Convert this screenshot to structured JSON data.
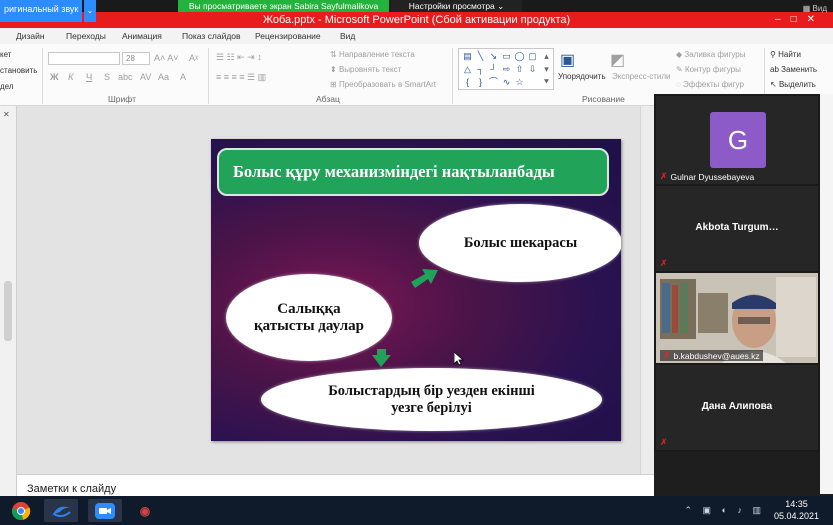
{
  "zoom": {
    "original_sound": "ригинальный звук",
    "share_banner": "Вы просматриваете экран Sabira Sayfulmalikova",
    "view_options": "Настройки просмотра ⌄",
    "view_label": "Вид"
  },
  "powerpoint": {
    "title": "Жоба.pptx  -  Microsoft PowerPoint (Сбой активации продукта)",
    "tabs": [
      "Дизайн",
      "Переходы",
      "Анимация",
      "Показ слайдов",
      "Рецензирование",
      "Вид"
    ],
    "clipboard": {
      "cut": "кет",
      "copy": "становить",
      "paste": "дел"
    },
    "font_size": "28",
    "font_group_label": "Шрифт",
    "paragraph_group_label": "Абзац",
    "text_direction": "Направление текста",
    "align_text": "Выровнять текст",
    "convert_smartart": "Преобразовать в SmartArt",
    "arrange": "Упорядочить",
    "express_styles": "Экспресс-стили",
    "drawing_group_label": "Рисование",
    "shape_fill": "Заливка фигуры",
    "shape_outline": "Контур фигуры",
    "shape_effects": "Эффекты фигур",
    "find": "Найти",
    "replace": "Заменить",
    "select": "Выделить",
    "notes_placeholder": "Заметки к слайду"
  },
  "slide": {
    "title": "Болыс құру механизміндегі нақтыланбады",
    "ellipse_border": "Болыс шекарасы",
    "ellipse_tax_line1": "Салыққа",
    "ellipse_tax_line2": "қатысты даулар",
    "ellipse_division_line1": "Болыстардың бір уезден екінші",
    "ellipse_division_line2": "уезге берілуі"
  },
  "participants": [
    {
      "name": "Gulnar Dyussebayeva",
      "avatar_letter": "G",
      "muted": true
    },
    {
      "name": "Akbota  Turgum…",
      "muted": true
    },
    {
      "name": "b.kabdushev@aues.kz",
      "muted": true
    },
    {
      "name": "Дана Алипова",
      "muted": true
    }
  ],
  "taskbar": {
    "time": "14:35",
    "date": "05.04.2021"
  },
  "colors": {
    "zoom_blue": "#2d8cff",
    "zoom_green": "#23b33c",
    "title_red": "#e81c1c",
    "slide_title_green": "#22a35a",
    "avatar_purple": "#8c5bc7"
  }
}
